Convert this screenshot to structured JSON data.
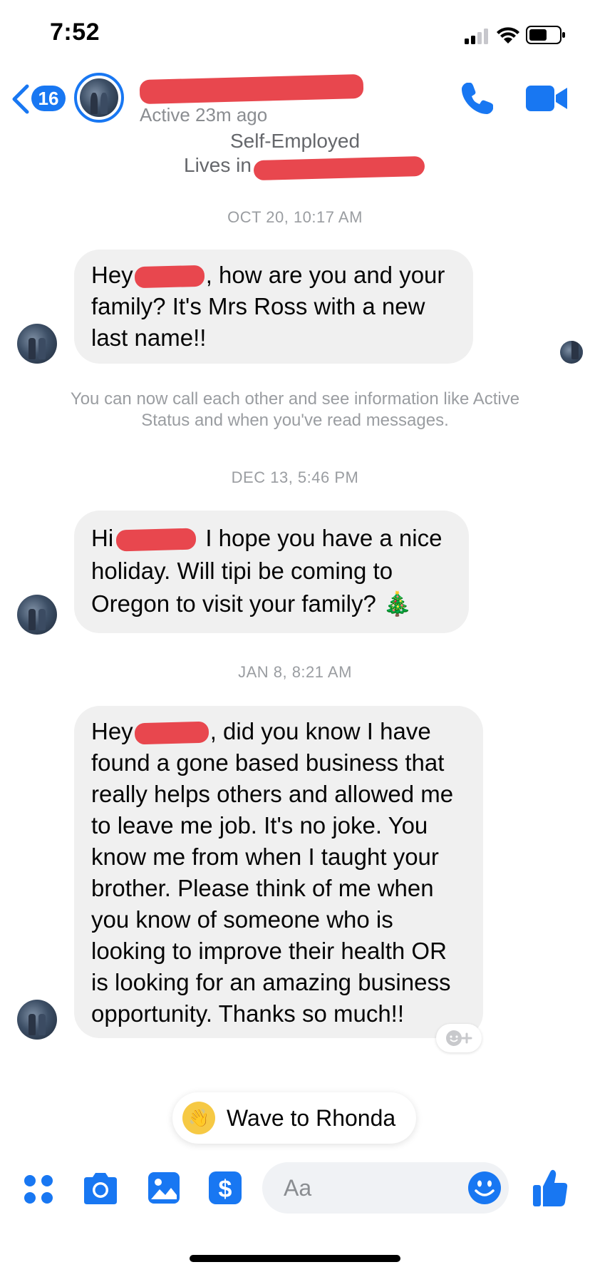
{
  "status_bar": {
    "time": "7:52"
  },
  "header": {
    "back_count": "16",
    "active_status": "Active 23m ago"
  },
  "profile": {
    "work": "Self-Employed",
    "lives_prefix": "Lives in"
  },
  "thread": {
    "stamp1": "OCT 20, 10:17 AM",
    "msg1": {
      "prefix": "Hey",
      "rest": ", how are you and your family?   It's Mrs Ross with a new last name!!"
    },
    "notice": "You can now call each other and see information like Active Status and when you've read messages.",
    "stamp2": "DEC 13, 5:46 PM",
    "msg2": {
      "prefix": "Hi",
      "rest": " I hope you have a nice holiday. Will tipi be coming to Oregon to visit your family? 🎄"
    },
    "stamp3": "JAN 8, 8:21 AM",
    "msg3": {
      "prefix": "Hey",
      "rest": ", did you know I have found a gone based business that really helps others and allowed me to leave me job. It's no joke. You know me from when I taught your brother. Please think of me when you know of someone who is looking to improve their health OR is looking for an amazing business opportunity. Thanks so much!!"
    }
  },
  "wave_button": {
    "label": "Wave to Rhonda",
    "icon": "waving-hand-icon"
  },
  "composer": {
    "placeholder": "Aa",
    "icons": [
      "apps-icon",
      "camera-icon",
      "gallery-icon",
      "payment-icon",
      "emoji-icon",
      "like-icon"
    ]
  },
  "colors": {
    "accent": "#1877f2",
    "bubble": "#f0f0f0",
    "redaction": "#e8474e",
    "wave": "#f6c944"
  }
}
